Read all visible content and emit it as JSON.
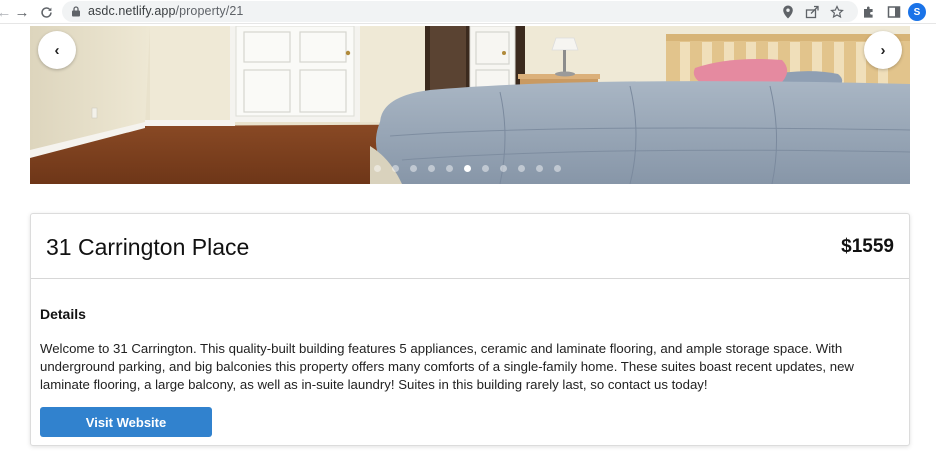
{
  "browser": {
    "url_host": "asdc.netlify.app",
    "url_path": "/property/21",
    "profile_initial": "S",
    "icons": {
      "back": "arrow-left",
      "forward": "arrow-right",
      "reload": "reload",
      "lock": "lock",
      "location": "map-pin",
      "share": "share",
      "bookmark": "star",
      "extensions": "puzzle",
      "side_panel": "side-panel"
    }
  },
  "carousel": {
    "prev_symbol": "‹",
    "next_symbol": "›",
    "slide_count": 11,
    "active_index": 5
  },
  "property": {
    "title": "31 Carrington Place",
    "price": "$1559",
    "details_heading": "Details",
    "description": "Welcome to 31 Carrington. This quality-built building features 5 appliances, ceramic and laminate flooring, and ample storage space. With underground parking, and big balconies this property offers many comforts of a single-family home. These suites boast recent updates, new laminate flooring, a large balcony, as well as in-suite laundry! Suites in this building rarely last, so contact us today!",
    "visit_button": "Visit Website"
  },
  "colors": {
    "accent": "#3182ce",
    "avatar": "#1a73e8"
  }
}
